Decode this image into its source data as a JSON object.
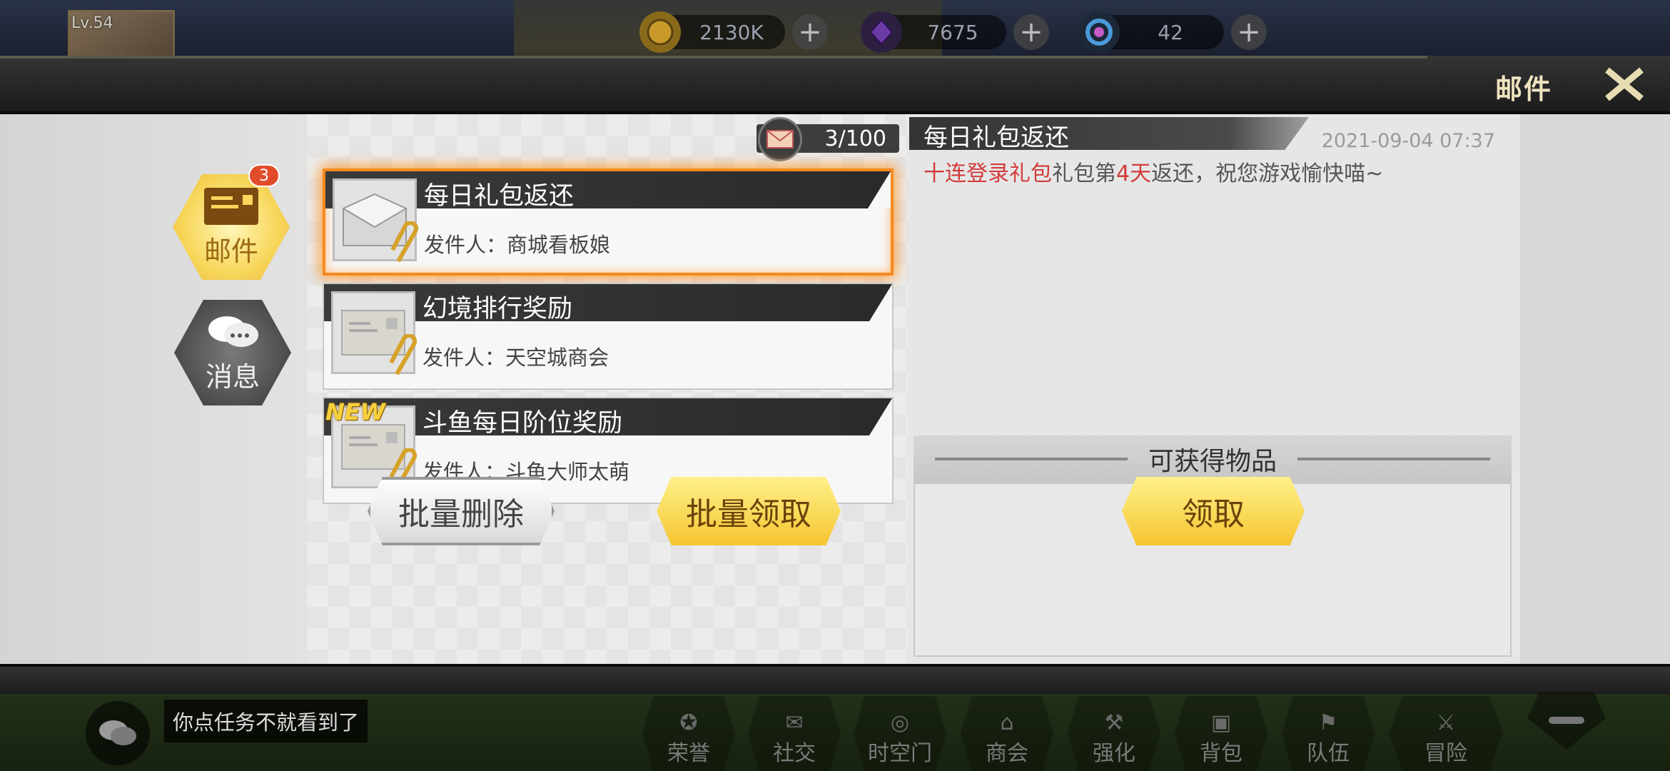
{
  "hud": {
    "player_level": "Lv.54",
    "gold": "2130K",
    "gems": "7675",
    "orbs": "42",
    "plus": "+"
  },
  "header": {
    "title": "邮件"
  },
  "tabs": [
    {
      "label": "邮件",
      "badge": "3"
    },
    {
      "label": "消息"
    }
  ],
  "mailbox": {
    "count": "3/100",
    "items": [
      {
        "subject": "每日礼包返还",
        "sender": "发件人：商城看板娘",
        "is_new": false
      },
      {
        "subject": "幻境排行奖励",
        "sender": "发件人：天空城商会",
        "is_new": false
      },
      {
        "subject": "斗鱼每日阶位奖励",
        "sender": "发件人：斗鱼大师太萌",
        "is_new": true,
        "new_label": "NEW"
      }
    ],
    "batch_delete_label": "批量删除",
    "batch_claim_label": "批量领取"
  },
  "detail": {
    "title": "每日礼包返还",
    "date": "2021-09-04  07:37",
    "body_parts": [
      "十连登录礼包",
      "礼包第",
      "4天",
      "返还，祝您游戏愉快喵~"
    ],
    "rewards_label": "可获得物品",
    "claim_label": "领取"
  },
  "chat": {
    "text": "你点任务不就看到了"
  },
  "nav": [
    {
      "label": "荣誉"
    },
    {
      "label": "社交"
    },
    {
      "label": "时空门"
    },
    {
      "label": "商会"
    },
    {
      "label": "强化"
    },
    {
      "label": "背包"
    },
    {
      "label": "队伍"
    },
    {
      "label": "冒险"
    }
  ],
  "colors": {
    "accent_gold": "#f5c530",
    "selected_glow": "#f58a1f",
    "highlight_red": "#d23b3b"
  }
}
